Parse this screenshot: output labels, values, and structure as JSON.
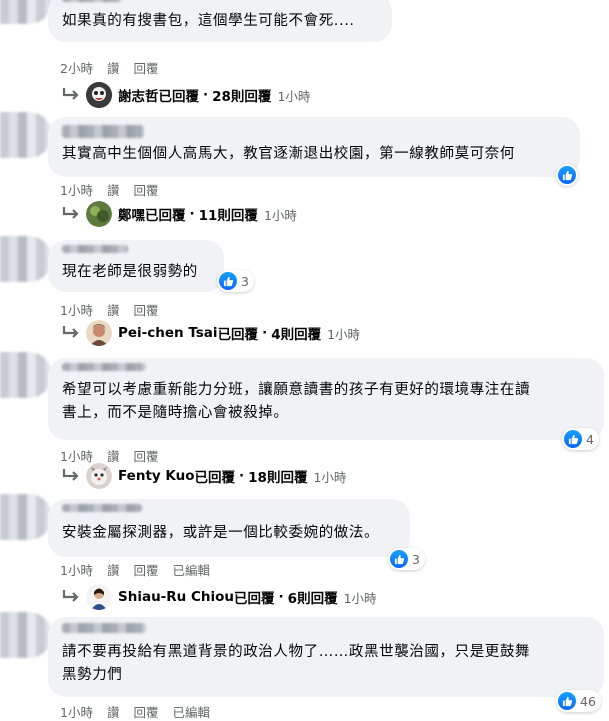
{
  "colors": {
    "like_blue": "#0866ff",
    "bubble_bg": "#f0f2f5",
    "meta_gray": "#65676b"
  },
  "comments": [
    {
      "text": "如果真的有搜書包，這個學生可能不會死....",
      "time": "2小時",
      "reply": "讚",
      "reply2": "回覆",
      "replies": {
        "name": "謝志哲",
        "suffix": "已回覆",
        "count": "28則回覆",
        "time": "1小時"
      }
    },
    {
      "text": "其實高中生個個人高馬大，教官逐漸退出校園，第一線教師莫可奈何",
      "time": "1小時",
      "reply": "讚",
      "reply2": "回覆",
      "replies": {
        "name": "鄭嘿",
        "suffix": "已回覆",
        "count": "11則回覆",
        "time": "1小時"
      }
    },
    {
      "text": "現在老師是很弱勢的",
      "likes": "3",
      "time": "1小時",
      "reply": "讚",
      "reply2": "回覆",
      "replies": {
        "name": "Pei-chen Tsai",
        "suffix": "已回覆",
        "count": "4則回覆",
        "time": "1小時"
      }
    },
    {
      "text_line1": "希望可以考慮重新能力分班，讓願意讀書的孩子有更好的環境專注在讀",
      "text_line2": "書上，而不是隨時擔心會被殺掉。",
      "likes": "4",
      "time": "1小時",
      "reply": "讚",
      "reply2": "回覆",
      "replies": {
        "name": "Fenty Kuo",
        "suffix": "已回覆",
        "count": "18則回覆",
        "time": "1小時"
      }
    },
    {
      "text": "安裝金屬探測器，或許是一個比較委婉的做法。",
      "likes": "3",
      "time": "1小時",
      "reply": "讚",
      "reply2": "回覆",
      "edited": "已編輯",
      "replies": {
        "name": "Shiau-Ru Chiou",
        "suffix": "已回覆",
        "count": "6則回覆",
        "time": "1小時"
      }
    },
    {
      "text_line1": "請不要再投給有黑道背景的政治人物了……政黑世襲治國，只是更鼓舞",
      "text_line2": "黑勢力們",
      "likes": "46",
      "time": "1小時",
      "reply": "讚",
      "reply2": "回覆",
      "edited": "已編輯"
    }
  ]
}
